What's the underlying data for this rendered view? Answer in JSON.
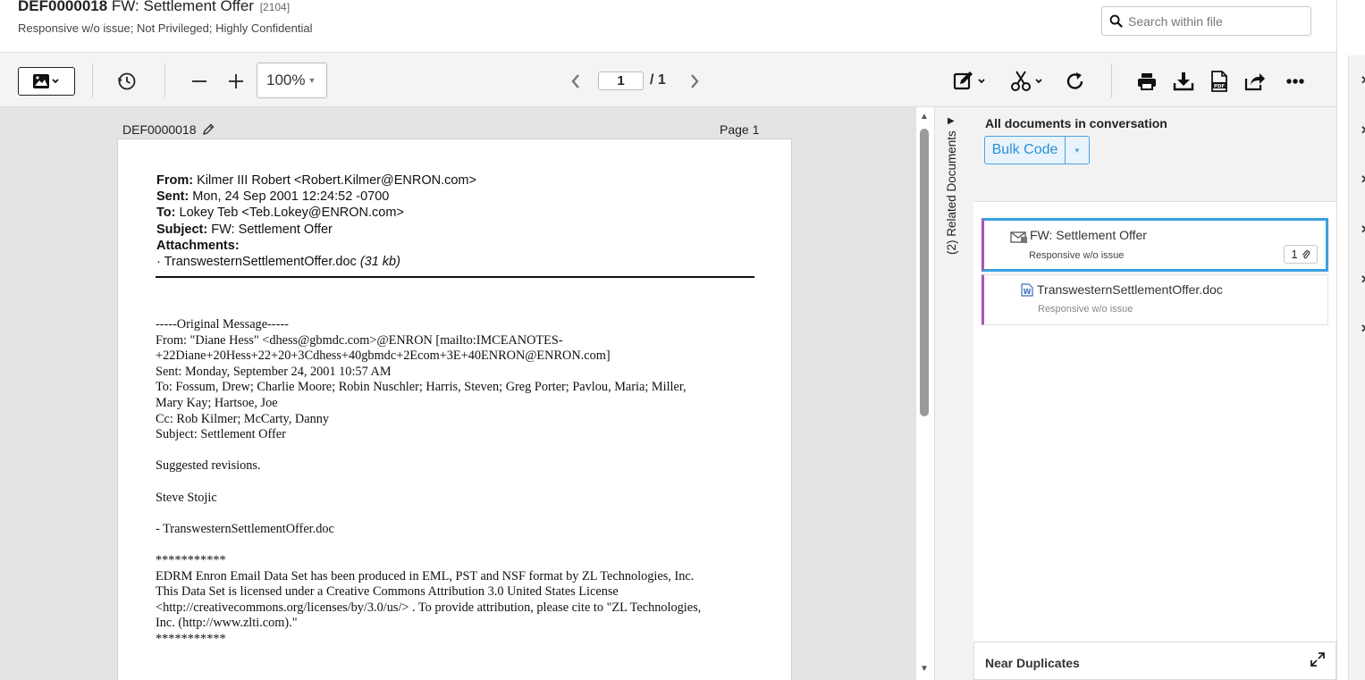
{
  "header": {
    "doc_id": "DEF0000018",
    "doc_title": "FW: Settlement Offer",
    "doc_count": "[2104]",
    "coding_summary": "Responsive w/o issue; Not Privileged; Highly Confidential",
    "search_placeholder": "Search within file"
  },
  "toolbar": {
    "zoom": "100%",
    "current_page": "1",
    "total_pages": "/ 1",
    "icons": [
      "image-view-icon",
      "history-icon",
      "zoom-out-icon",
      "zoom-in-icon",
      "prev-page-icon",
      "next-page-icon",
      "annotate-icon",
      "redact-icon",
      "rotate-icon",
      "print-icon",
      "download-icon",
      "pdf-icon",
      "share-icon",
      "more-icon"
    ]
  },
  "viewer": {
    "doc_label": "DEF0000018",
    "page_label": "Page 1",
    "email_header": [
      {
        "label": "From:",
        "value": "Kilmer III Robert <Robert.Kilmer@ENRON.com>"
      },
      {
        "label": "Sent:",
        "value": "Mon, 24 Sep 2001 12:24:52 -0700"
      },
      {
        "label": "To:",
        "value": "Lokey Teb <Teb.Lokey@ENRON.com>"
      },
      {
        "label": "Subject:",
        "value": "FW: Settlement Offer"
      },
      {
        "label": "Attachments:",
        "value": ""
      }
    ],
    "attachment_line": "· TranswesternSettlementOffer.doc",
    "attachment_size": "(31 kb)",
    "body_lines": [
      "-----Original Message-----",
      "From: \"Diane Hess\" <dhess@gbmdc.com>@ENRON [mailto:IMCEANOTES-",
      "+22Diane+20Hess+22+20+3Cdhess+40gbmdc+2Ecom+3E+40ENRON@ENRON.com]",
      "Sent: Monday, September 24, 2001 10:57 AM",
      "To: Fossum, Drew; Charlie Moore; Robin Nuschler; Harris, Steven; Greg Porter; Pavlou, Maria; Miller,",
      "Mary Kay; Hartsoe, Joe",
      "Cc: Rob Kilmer; McCarty, Danny",
      "Subject: Settlement Offer",
      "",
      "Suggested revisions.",
      "",
      "Steve Stojic",
      "",
      "- TranswesternSettlementOffer.doc",
      "",
      "***********",
      "EDRM Enron Email Data Set has been produced in EML, PST and NSF format by ZL Technologies, Inc.",
      "This Data Set is licensed under a Creative Commons Attribution 3.0 United States License",
      "<http://creativecommons.org/licenses/by/3.0/us/> . To provide attribution, please cite to \"ZL Technologies,",
      "Inc. (http://www.zlti.com).\"",
      "***********"
    ]
  },
  "related_tab": {
    "label": "(2) Related Documents"
  },
  "conversation": {
    "title": "All documents in conversation",
    "bulk_code_label": "Bulk Code",
    "items": [
      {
        "name": "FW: Settlement Offer",
        "status": "Responsive w/o issue",
        "attachments": "1",
        "icon": "email-attachment-icon"
      },
      {
        "name": "TranswesternSettlementOffer.doc",
        "status": "Responsive w/o issue",
        "icon": "word-doc-icon"
      }
    ],
    "near_duplicates_label": "Near Duplicates"
  },
  "colors": {
    "accent_blue": "#3aa0e0",
    "family_purple": "#a855b5",
    "toolbar_bg": "#f4f4f4",
    "viewer_bg": "#e3e3e3"
  }
}
